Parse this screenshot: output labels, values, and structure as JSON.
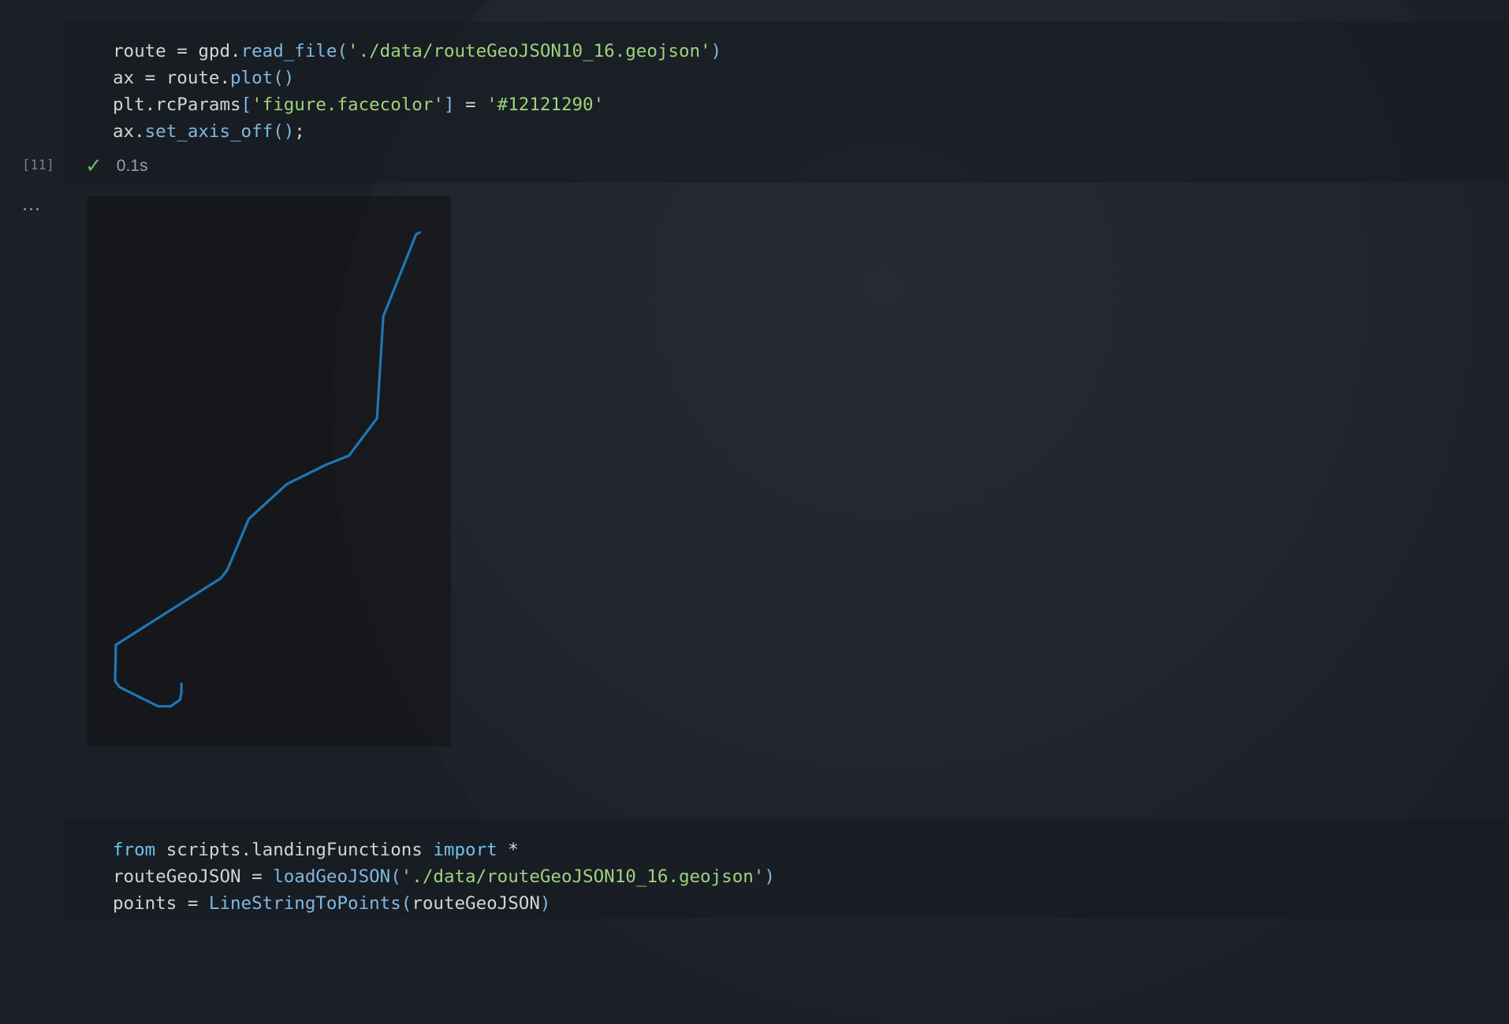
{
  "cell1": {
    "exec_count": "[11]",
    "status_icon": "check-icon",
    "duration": "0.1s",
    "code_lines": [
      [
        [
          "op",
          "route = gpd."
        ],
        [
          "fn",
          "read_file"
        ],
        [
          "fn",
          "("
        ],
        [
          "str",
          "'./data/routeGeoJSON10_16.geojson'"
        ],
        [
          "fn",
          ")"
        ]
      ],
      [
        [
          "op",
          "ax = route."
        ],
        [
          "fn",
          "plot"
        ],
        [
          "fn",
          "()"
        ]
      ],
      [
        [
          "op",
          "plt.rcParams"
        ],
        [
          "fn",
          "["
        ],
        [
          "str",
          "'figure.facecolor'"
        ],
        [
          "fn",
          "]"
        ],
        [
          "op",
          " = "
        ],
        [
          "str",
          "'#12121290'"
        ]
      ],
      [
        [
          "op",
          "ax."
        ],
        [
          "fn",
          "set_axis_off"
        ],
        [
          "fn",
          "()"
        ],
        [
          "op",
          ";"
        ]
      ]
    ]
  },
  "output": {
    "menu_label": "...",
    "plot_background": "#12121290",
    "line_color": "#1f77b4",
    "route_points": [
      [
        0.914,
        0.066
      ],
      [
        0.904,
        0.07
      ],
      [
        0.814,
        0.219
      ],
      [
        0.797,
        0.404
      ],
      [
        0.72,
        0.472
      ],
      [
        0.659,
        0.488
      ],
      [
        0.579,
        0.514
      ],
      [
        0.549,
        0.524
      ],
      [
        0.445,
        0.587
      ],
      [
        0.386,
        0.68
      ],
      [
        0.368,
        0.695
      ],
      [
        0.08,
        0.816
      ],
      [
        0.078,
        0.882
      ],
      [
        0.09,
        0.893
      ],
      [
        0.196,
        0.928
      ],
      [
        0.23,
        0.928
      ],
      [
        0.256,
        0.916
      ],
      [
        0.26,
        0.903
      ],
      [
        0.26,
        0.887
      ]
    ]
  },
  "cell2": {
    "code_lines": [
      [
        [
          "kw",
          "from"
        ],
        [
          "op",
          " scripts.landingFunctions "
        ],
        [
          "kw",
          "import"
        ],
        [
          "op",
          " *"
        ]
      ],
      [
        [
          "op",
          "routeGeoJSON = "
        ],
        [
          "fn",
          "loadGeoJSON("
        ],
        [
          "str",
          "'./data/routeGeoJSON10_16.geojson'"
        ],
        [
          "fn",
          ")"
        ]
      ],
      [
        [
          "op",
          "points = "
        ],
        [
          "fn",
          "LineStringToPoints("
        ],
        [
          "op",
          "routeGeoJSON"
        ],
        [
          "fn",
          ")"
        ]
      ]
    ]
  }
}
